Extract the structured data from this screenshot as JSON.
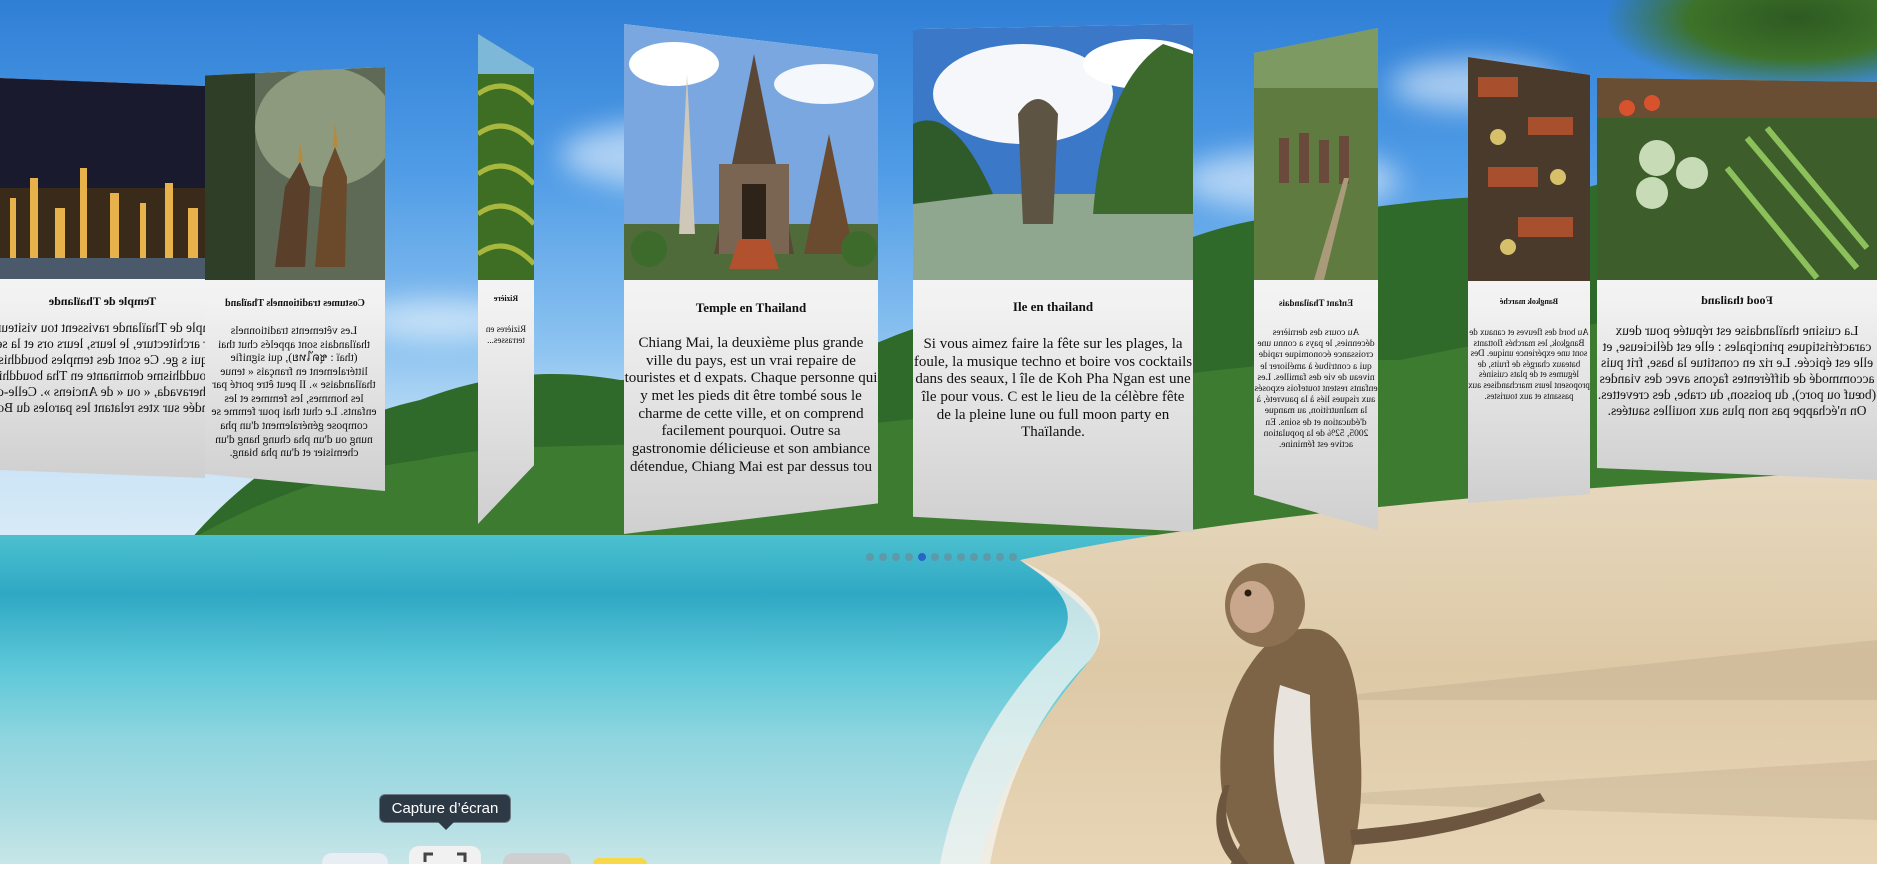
{
  "tooltip": {
    "label": "Capture d’écran"
  },
  "carousel": {
    "dot_count": 12,
    "active_dot": 4,
    "cards": [
      {
        "title": "Temple de Thaïlande",
        "text": "emple de Thaïlande ravissent tou visiteurs par leur architecture, le leurs, leurs ors et la sérénité qui s ge. Ce sont des temples bouddhis de bouddhisme dominante en Tha bouddhisme Theravada, « ou « de Anciens ». Celle-ci est fondée sur xtes relatant les paroles du Bouddh"
      },
      {
        "title": "Costumes traditionnels Thaïland",
        "text": "Les vêtements traditionnels thaïlandais sont appelés chut thai (thaï : ชุดไทย), qui signifie littéralement en français « tenue thaïlandaise ». Il peut être porté par les hommes, les femmes et les enfants. Le chut thai pour femme se compose généralement d'un pha nung ou d'un pha chung hang d'un chemisier et d'un pha biang."
      },
      {
        "title": "Rizière",
        "text": "Rizières en terrasses..."
      },
      {
        "title": "Temple en Thailand",
        "text": "Chiang Mai, la deuxième plus grande ville du pays, est un vrai repaire de touristes et d expats. Chaque personne qui y met les pieds dit être tombé sous le charme de cette ville, et on comprend facilement pourquoi. Outre sa gastronomie délicieuse et son ambiance détendue, Chiang Mai est par dessus tou"
      },
      {
        "title": "Ile en thailand",
        "text": "Si vous aimez faire la fête sur les plages, la foule, la musique techno et boire vos cocktails dans des seaux, l île de Koh Pha Ngan est une île pour vous. C est le lieu de la célèbre fête de la pleine lune ou full moon party en Thaïlande."
      },
      {
        "title": "Enfant Thaïlandais",
        "text": "Au cours des dernières décennies, le pays a connu une croissance économique rapide qui a contribué à améliorer le niveau de vie des familles. Les enfants restent toutefois exposés aux risques liés à la pauvreté, à la malnutrition, au manque d'éducation et de soins. En 2005, 52% de la population active est féminine."
      },
      {
        "title": "Bangkok marché",
        "text": "Au bord des fleuves et canaux de Bangkok, les marchés flottants sont une expérience unique. Des bateaux chargés de fruits, de légumes et de plats cuisinés proposent leurs marchandises aux passants et aux touristes."
      },
      {
        "title": "Food thailand",
        "text": "La cuisine thaïlandaise est réputée pour deux caractéristiques principales : elle est délicieuse, et elle est épicée. Le riz en constitue la base, frit puis accommodé de différentes façons avec des viandes (bœuf ou porc), du poisson, du crabe, des crevettes. On n'échappe pas non plus aux nouilles sautées."
      }
    ]
  },
  "dock": {
    "items": [
      {
        "name": "dock-finder-icon",
        "color": "#e9eef5"
      },
      {
        "name": "dock-screenshot-icon",
        "color": "#f1f1f1"
      },
      {
        "name": "dock-app-icon",
        "color": "#cfcfcf"
      },
      {
        "name": "dock-notes-icon",
        "color": "#f6d84a"
      }
    ]
  }
}
